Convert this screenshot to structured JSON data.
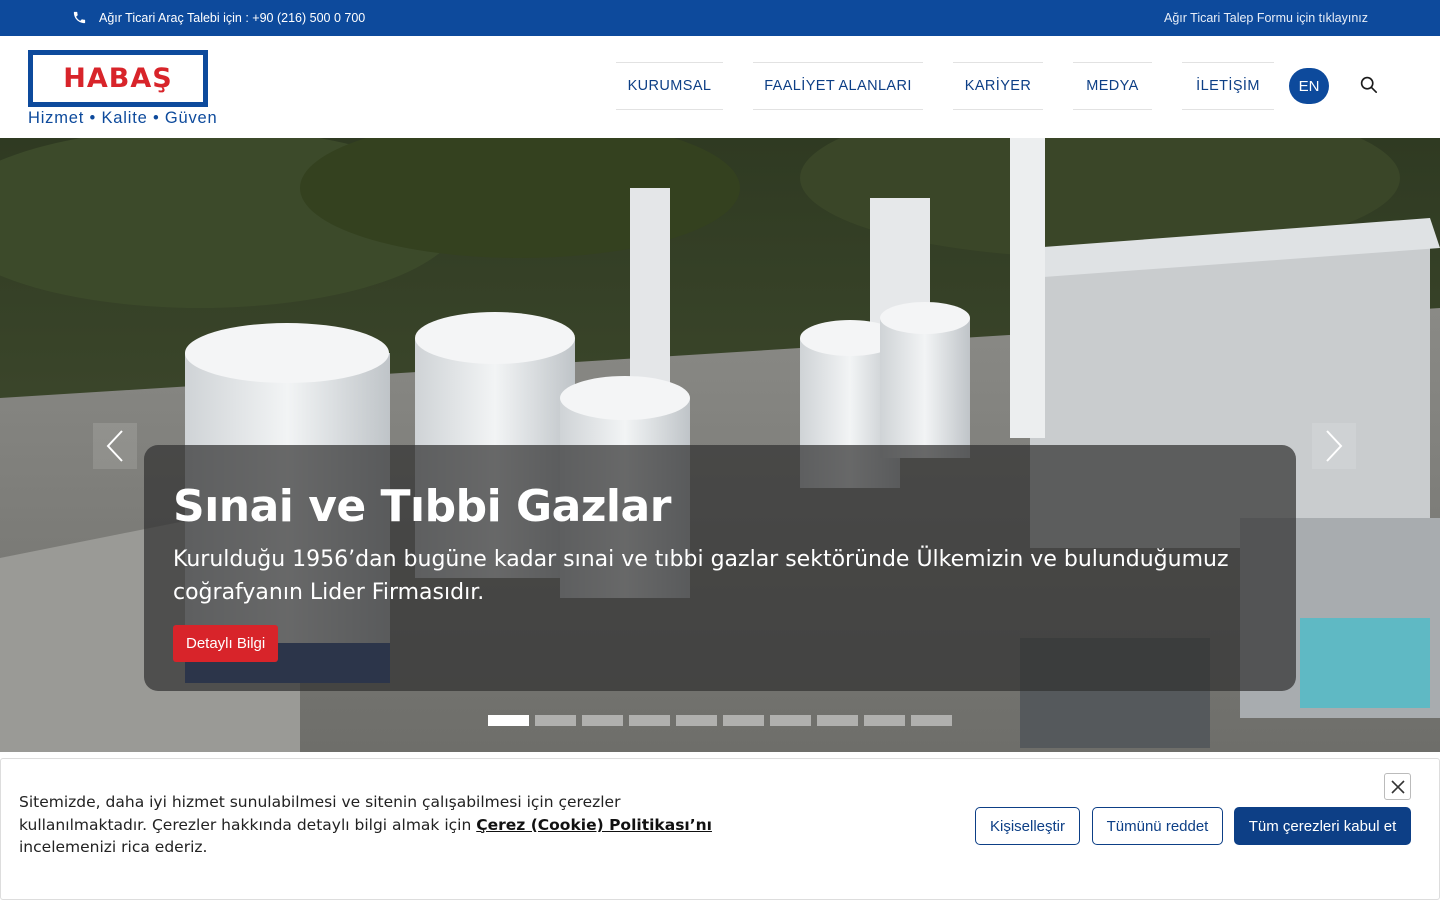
{
  "topbar": {
    "phone_text": "Ağır Ticari Araç Talebi için : +90 (216) 500 0 700",
    "request_link": "Ağır Ticari Talep Formu için tıklayınız"
  },
  "header": {
    "logo_text": "HABAŞ",
    "slogan": "Hizmet • Kalite • Güven",
    "nav": [
      "KURUMSAL",
      "FAALİYET ALANLARI",
      "KARİYER",
      "MEDYA",
      "İLETİŞİM"
    ],
    "lang": "EN"
  },
  "hero": {
    "title": "Sınai ve Tıbbi Gazlar",
    "description": "Kurulduğu 1956’dan bugüne kadar sınai ve tıbbi gazlar sektöründe Ülkemizin ve bulunduğumuz coğrafyanın Lider Firmasıdır.",
    "button": "Detaylı Bilgi",
    "slide_count": 10,
    "active_slide": 1
  },
  "cookie": {
    "text_before": "Sitemizde, daha iyi hizmet sunulabilmesi ve sitenin çalışabilmesi için çerezler kullanılmaktadır. Çerezler hakkında detaylı bilgi almak için ",
    "link": "Çerez (Cookie) Politikası’nı",
    "text_after": " incelemenizi rica ederiz.",
    "customize": "Kişiselleştir",
    "reject": "Tümünü reddet",
    "accept": "Tüm çerezleri kabul et"
  },
  "colors": {
    "brand_blue": "#0d4a9c",
    "brand_red": "#d8242a",
    "nav_text": "#0d3f86"
  }
}
